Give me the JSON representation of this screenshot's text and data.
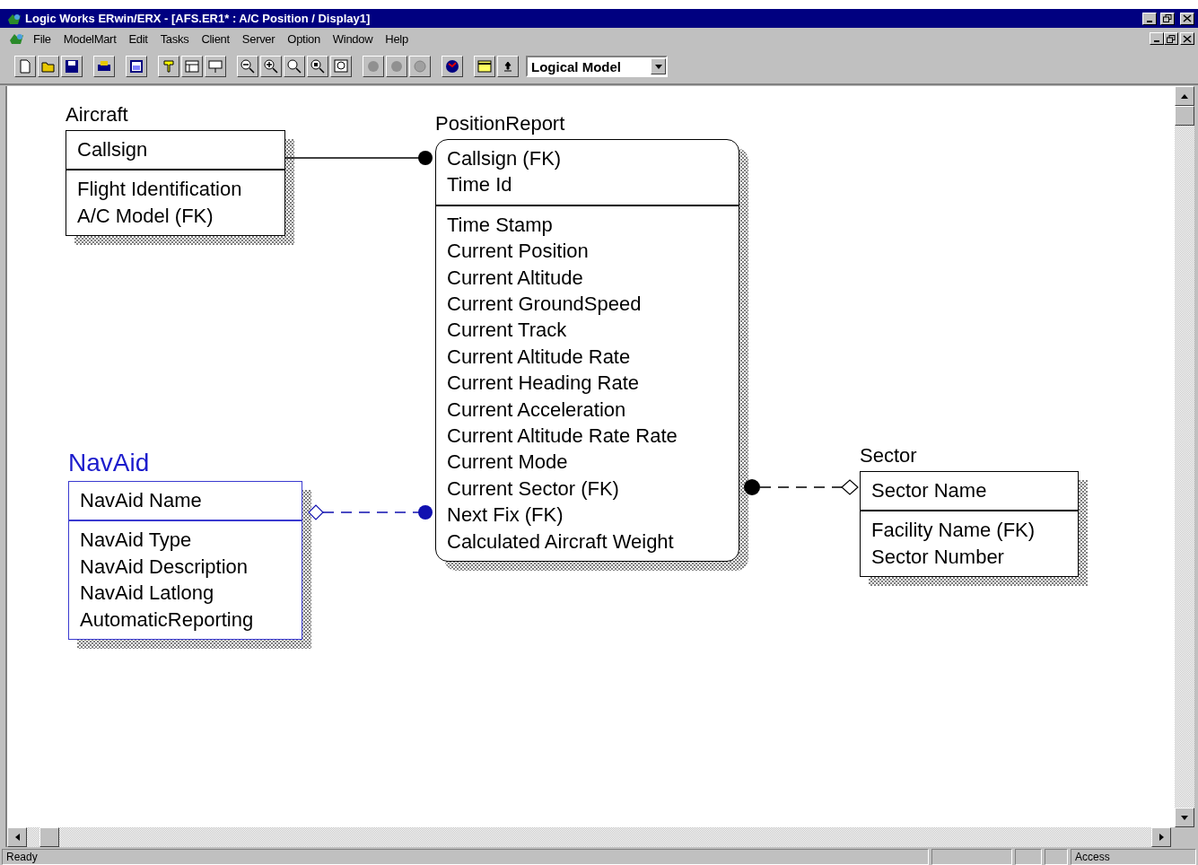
{
  "window": {
    "title": "Logic Works ERwin/ERX - [AFS.ER1* : A/C Position / Display1]"
  },
  "menu": [
    "File",
    "ModelMart",
    "Edit",
    "Tasks",
    "Client",
    "Server",
    "Option",
    "Window",
    "Help"
  ],
  "toolbar": {
    "model_selector": "Logical Model"
  },
  "entities": [
    {
      "name": "Aircraft",
      "selected": false,
      "key_attributes": [
        "Callsign"
      ],
      "attributes": [
        "Flight Identification",
        "A/C Model (FK)"
      ]
    },
    {
      "name": "PositionReport",
      "selected": false,
      "key_attributes": [
        "Callsign (FK)",
        "Time Id"
      ],
      "attributes": [
        "Time Stamp",
        "Current Position",
        "Current Altitude",
        "Current GroundSpeed",
        "Current Track",
        "Current Altitude Rate",
        "Current Heading Rate",
        "Current Acceleration",
        "Current Altitude Rate Rate",
        "Current Mode",
        "Current Sector (FK)",
        "Next Fix (FK)",
        "Calculated Aircraft Weight"
      ]
    },
    {
      "name": "NavAid",
      "selected": true,
      "key_attributes": [
        "NavAid Name"
      ],
      "attributes": [
        "NavAid Type",
        "NavAid Description",
        "NavAid Latlong",
        "AutomaticReporting"
      ]
    },
    {
      "name": "Sector",
      "selected": false,
      "key_attributes": [
        "Sector Name"
      ],
      "attributes": [
        "Facility Name (FK)",
        "Sector Number"
      ]
    }
  ],
  "relationships": [
    {
      "kind": "identifying",
      "selected": false
    },
    {
      "kind": "non-identifying",
      "selected": true
    },
    {
      "kind": "non-identifying",
      "selected": false
    }
  ],
  "status_bar": {
    "message": "Ready",
    "mode": "Access"
  }
}
